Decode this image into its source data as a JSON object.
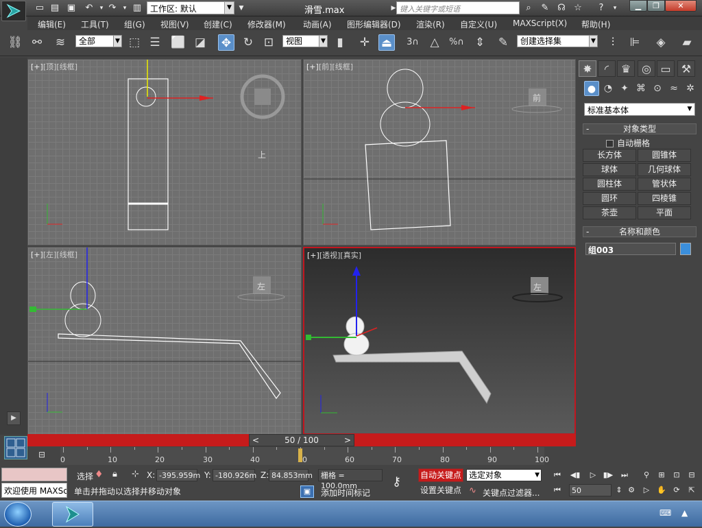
{
  "app": {
    "file_title": "滑雪.max",
    "workspace_label": "工作区: 默认",
    "search_placeholder": "键入关键字或短语"
  },
  "menus": [
    "编辑(E)",
    "工具(T)",
    "组(G)",
    "视图(V)",
    "创建(C)",
    "修改器(M)",
    "动画(A)",
    "图形编辑器(D)",
    "渲染(R)",
    "自定义(U)",
    "MAXScript(X)",
    "帮助(H)"
  ],
  "toolbar": {
    "selection_filter": "全部",
    "ref_coord": "视图",
    "named_selection": "创建选择集",
    "snap_angle": "3",
    "percent_snap": "%"
  },
  "viewports": {
    "top": {
      "plus": "[+]",
      "view": "[顶]",
      "shade": "[线框]",
      "cube_label": "上"
    },
    "front": {
      "plus": "[+]",
      "view": "[前]",
      "shade": "[线框]",
      "cube_label": "前"
    },
    "left": {
      "plus": "[+]",
      "view": "[左]",
      "shade": "[线框]",
      "cube_label": "左"
    },
    "persp": {
      "plus": "[+]",
      "view": "[透视]",
      "shade": "[真实]",
      "cube_label": "左"
    }
  },
  "command_panel": {
    "category": "标准基本体",
    "object_type_title": "对象类型",
    "autogrid_label": "自动栅格",
    "object_buttons": [
      "长方体",
      "圆锥体",
      "球体",
      "几何球体",
      "圆柱体",
      "管状体",
      "圆环",
      "四棱锥",
      "茶壶",
      "平面"
    ],
    "name_color_title": "名称和颜色",
    "object_name": "组003",
    "object_color": "#3b8fdc"
  },
  "timeline": {
    "frame_display": "50 / 100",
    "current_frame": 50,
    "total_frames": 100,
    "tick_labels": [
      "0",
      "10",
      "20",
      "30",
      "40",
      "50",
      "60",
      "70",
      "80",
      "90",
      "100"
    ]
  },
  "status": {
    "welcome": "欢迎使用 MAXSc",
    "select_label": "选择",
    "x_label": "X:",
    "x_value": "-395.959m",
    "y_label": "Y:",
    "y_value": "-180.926m",
    "z_label": "Z:",
    "z_value": "84.853mm",
    "grid_label": "栅格 = 100.0mm",
    "prompt": "单击并拖动以选择并移动对象",
    "add_time_tag": "添加时间标记",
    "auto_key": "自动关键点",
    "set_key": "设置关键点",
    "key_mode": "选定对象",
    "key_filter": "关键点过滤器...",
    "frame_field": "50"
  },
  "colors": {
    "accent_red": "#c61b1b",
    "active_blue": "#5a8fc9"
  }
}
